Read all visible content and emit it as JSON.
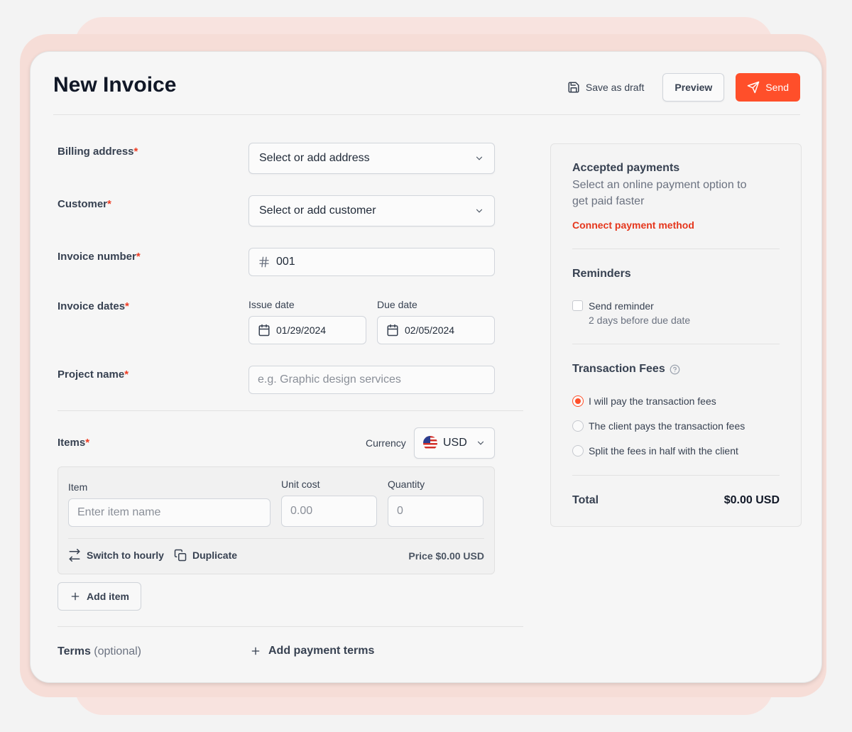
{
  "header": {
    "title": "New Invoice",
    "save_draft": "Save as draft",
    "preview": "Preview",
    "send": "Send"
  },
  "form": {
    "billing_label": "Billing address",
    "billing_select": "Select or add address",
    "customer_label": "Customer",
    "customer_select": "Select or add customer",
    "invoice_number_label": "Invoice number",
    "invoice_number_value": "001",
    "dates_label": "Invoice dates",
    "issue_date_label": "Issue date",
    "issue_date_value": "01/29/2024",
    "due_date_label": "Due date",
    "due_date_value": "02/05/2024",
    "project_label": "Project name",
    "project_placeholder": "e.g. Graphic design services",
    "required_mark": "*"
  },
  "items": {
    "label": "Items",
    "currency_label": "Currency",
    "currency_value": "USD",
    "col_item": "Item",
    "col_unit_cost": "Unit cost",
    "col_quantity": "Quantity",
    "item_placeholder": "Enter item name",
    "unit_cost_placeholder": "0.00",
    "quantity_placeholder": "0",
    "switch_hourly": "Switch to hourly",
    "duplicate": "Duplicate",
    "price": "Price $0.00 USD",
    "add_item": "Add item"
  },
  "terms": {
    "label": "Terms",
    "optional": "(optional)",
    "add_terms": "Add payment terms"
  },
  "sidebar": {
    "payments_title": "Accepted payments",
    "payments_text": "Select an online payment option to get paid faster",
    "connect_link": "Connect payment method",
    "reminders_title": "Reminders",
    "send_reminder": "Send reminder",
    "reminder_detail": "2 days before due date",
    "fees_title": "Transaction Fees",
    "fee_options": [
      "I will pay the transaction fees",
      "The client pays the transaction fees",
      "Split the fees in half with the client"
    ],
    "selected_fee_option": 0,
    "total_label": "Total",
    "total_value": "$0.00 USD"
  },
  "colors": {
    "accent": "#ff4f2a",
    "link": "#e5361c",
    "background_shape": "#f8e3df"
  }
}
